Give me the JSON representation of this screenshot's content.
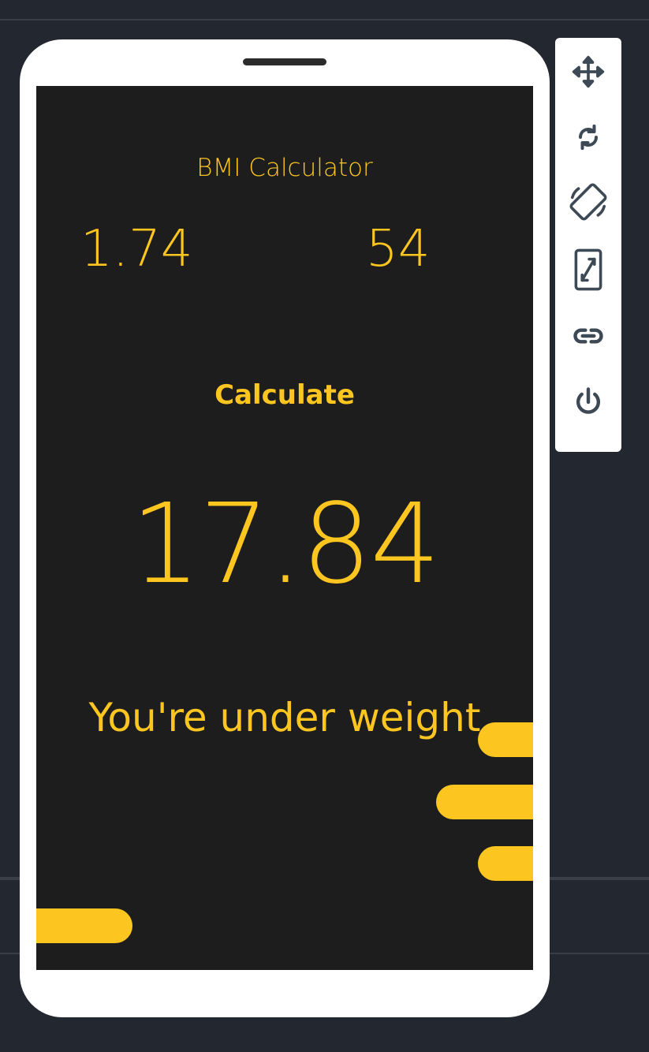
{
  "app": {
    "title": "BMI Calculator",
    "height_value": "1.74",
    "weight_value": "54",
    "calculate_label": "Calculate",
    "bmi_result": "17.84",
    "status_message": "You're under weight"
  },
  "colors": {
    "accent": "#fcc51f",
    "screen_bg": "#1d1d1d",
    "device_bg": "#ffffff",
    "page_bg": "#232830",
    "icon_color": "#3d4a55"
  },
  "toolbar": {
    "icons": [
      "move-icon",
      "rotate-icon",
      "screen-rotation-icon",
      "resize-icon",
      "link-icon",
      "power-icon"
    ]
  }
}
